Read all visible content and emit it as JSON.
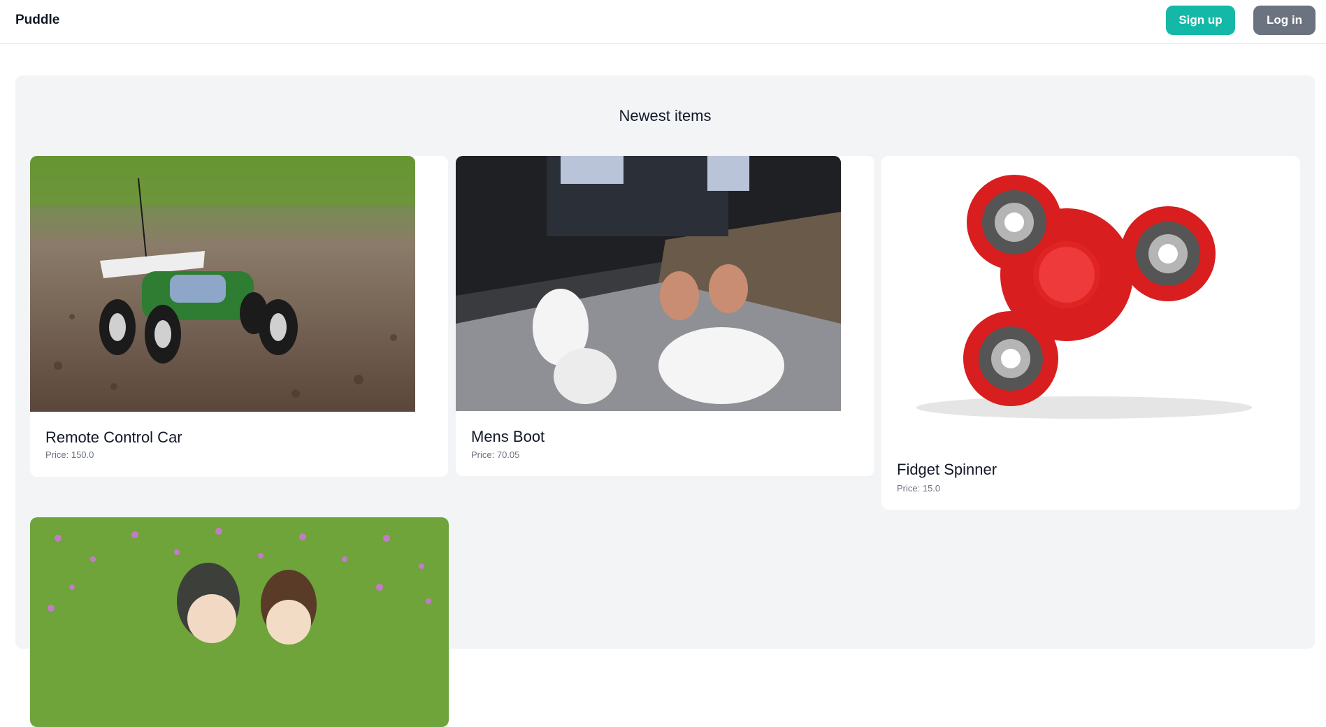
{
  "header": {
    "brand": "Puddle",
    "signup_label": "Sign up",
    "login_label": "Log in"
  },
  "main": {
    "section_title": "Newest items",
    "items": [
      {
        "name": "Remote Control Car",
        "price": "Price: 150.0",
        "image": "remote-control-car-photo"
      },
      {
        "name": "Mens Boot",
        "price": "Price: 70.05",
        "image": "white-sneakers-photo"
      },
      {
        "name": "Fidget Spinner",
        "price": "Price: 15.0",
        "image": "red-fidget-spinner-photo"
      },
      {
        "name": "",
        "price": "",
        "image": "anime-illustration-flowers"
      }
    ]
  },
  "colors": {
    "accent": "#14b8a6",
    "secondary": "#6b7280",
    "panel_bg": "#f3f4f6"
  }
}
